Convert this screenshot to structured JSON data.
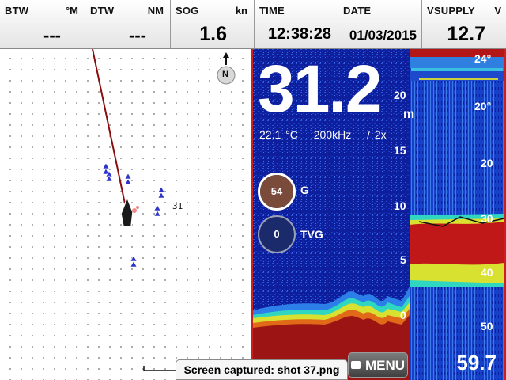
{
  "databar": [
    {
      "label": "BTW",
      "unit": "°M",
      "value": "---"
    },
    {
      "label": "DTW",
      "unit": "NM",
      "value": "---"
    },
    {
      "label": "SOG",
      "unit": "kn",
      "value": "1.6"
    },
    {
      "label": "TIME",
      "unit": "",
      "value": "12:38:28"
    },
    {
      "label": "DATE",
      "unit": "",
      "value": "01/03/2015"
    },
    {
      "label": "VSUPPLY",
      "unit": "V",
      "value": "12.7"
    }
  ],
  "chart": {
    "north_label": "N",
    "sounding": "31"
  },
  "sonar": {
    "depth": "31.2",
    "depth_unit": "m",
    "temperature": "22.1 °C",
    "frequency": "200kHz",
    "zoom": "/ 2x",
    "gain": {
      "value": "54",
      "label": "G"
    },
    "tvg": {
      "value": "0",
      "label": "TVG"
    },
    "left_scale": [
      "20",
      "15",
      "10",
      "5",
      "0"
    ],
    "right_scale": [
      "24°",
      "20°",
      "20",
      "30",
      "40",
      "50"
    ],
    "menu_label": "MENU",
    "bottom_depth": "59.7"
  },
  "toast": "Screen captured: shot 37.png",
  "colors": {
    "water": "#0e1f9e",
    "frame": "#cc1f1f",
    "track": "#8b0e0e"
  }
}
